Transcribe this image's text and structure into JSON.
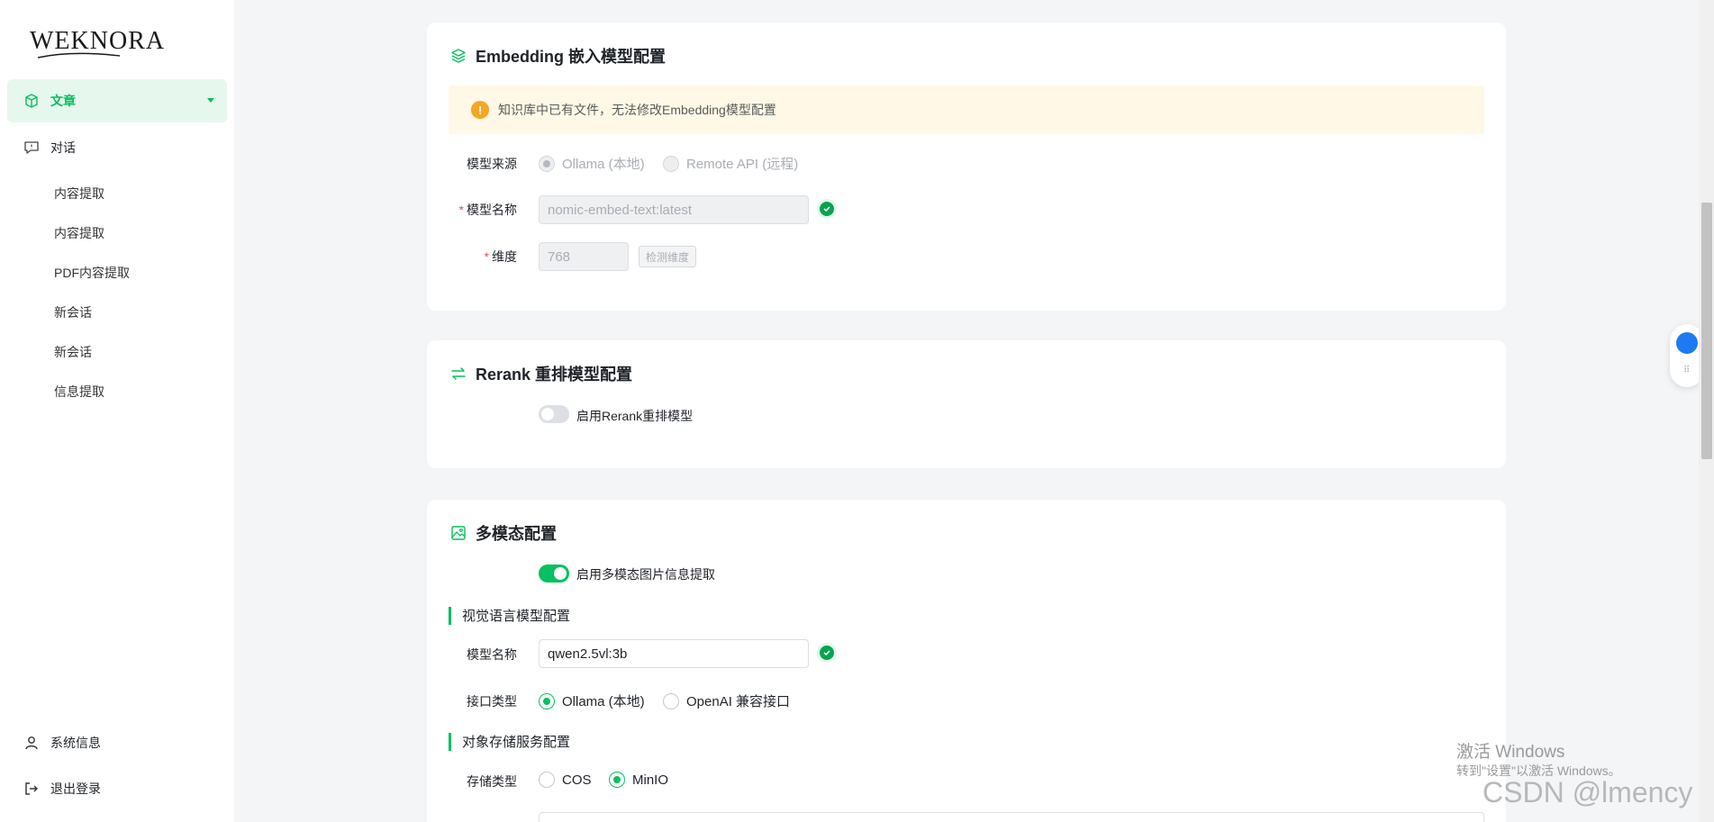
{
  "app": {
    "logo": "WEKNORA"
  },
  "sidebar": {
    "items": [
      {
        "label": "文章",
        "icon": "cube-icon",
        "active": true
      },
      {
        "label": "对话",
        "icon": "chat-icon"
      }
    ],
    "sub_items": [
      "内容提取",
      "内容提取",
      "PDF内容提取",
      "新会话",
      "新会话",
      "信息提取"
    ],
    "bottom": [
      {
        "label": "系统信息",
        "icon": "user-icon"
      },
      {
        "label": "退出登录",
        "icon": "logout-icon"
      }
    ]
  },
  "embedding": {
    "title": "Embedding 嵌入模型配置",
    "warning": "知识库中已有文件，无法修改Embedding模型配置",
    "source_label": "模型来源",
    "source_options": [
      "Ollama (本地)",
      "Remote API (远程)"
    ],
    "model_name_label": "模型名称",
    "model_name_value": "nomic-embed-text:latest",
    "dimension_label": "维度",
    "dimension_value": "768",
    "detect_button": "检测维度"
  },
  "rerank": {
    "title": "Rerank 重排模型配置",
    "toggle_label": "启用Rerank重排模型",
    "enabled": false
  },
  "multimodal": {
    "title": "多模态配置",
    "toggle_label": "启用多模态图片信息提取",
    "enabled": true,
    "vlm_section": "视觉语言模型配置",
    "model_name_label": "模型名称",
    "model_name_value": "qwen2.5vl:3b",
    "interface_label": "接口类型",
    "interface_options": [
      "Ollama (本地)",
      "OpenAI 兼容接口"
    ],
    "storage_section": "对象存储服务配置",
    "storage_label": "存储类型",
    "storage_options": [
      "COS",
      "MinIO"
    ]
  },
  "watermark": {
    "line1": "激活 Windows",
    "line2": "转到\"设置\"以激活 Windows。",
    "csdn": "CSDN @lmency"
  },
  "colors": {
    "accent": "#07c05f",
    "warning": "#f5a623",
    "warning_bg": "#fff8e6"
  }
}
